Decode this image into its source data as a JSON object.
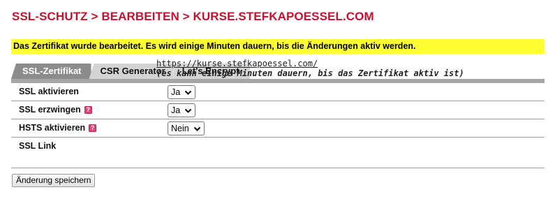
{
  "page_title": "SSL-SCHUTZ > BEARBEITEN > KURSE.STEFKAPOESSEL.COM",
  "notice": "Das Zertifikat wurde bearbeitet. Es wird einige Minuten dauern, bis die Änderungen aktiv werden.",
  "tabs": [
    {
      "label": "SSL-Zertifikat",
      "active": true
    },
    {
      "label": "CSR Generator",
      "active": false
    },
    {
      "label": "Let's Encrypt",
      "active": false
    }
  ],
  "settings": {
    "ssl_activate": {
      "label": "SSL aktivieren",
      "value": "Ja"
    },
    "ssl_force": {
      "label": "SSL erzwingen",
      "value": "Ja",
      "help_icon": "help-icon"
    },
    "hsts_activate": {
      "label": "HSTS aktivieren",
      "value": "Nein",
      "help_icon": "help-icon"
    },
    "ssl_link": {
      "label": "SSL Link",
      "url": "https://kurse.stefkapoessel.com/",
      "note": "(es kann einige Minuten dauern, bis das Zertifikat aktiv ist)"
    }
  },
  "save_button": "Änderung speichern",
  "colors": {
    "title": "#c8102e",
    "notice_bg": "#ffff33",
    "tab_active_bg": "#8c8c8c",
    "tab_inactive_bg": "#d4d4d4",
    "help_icon": "#e0447a"
  }
}
